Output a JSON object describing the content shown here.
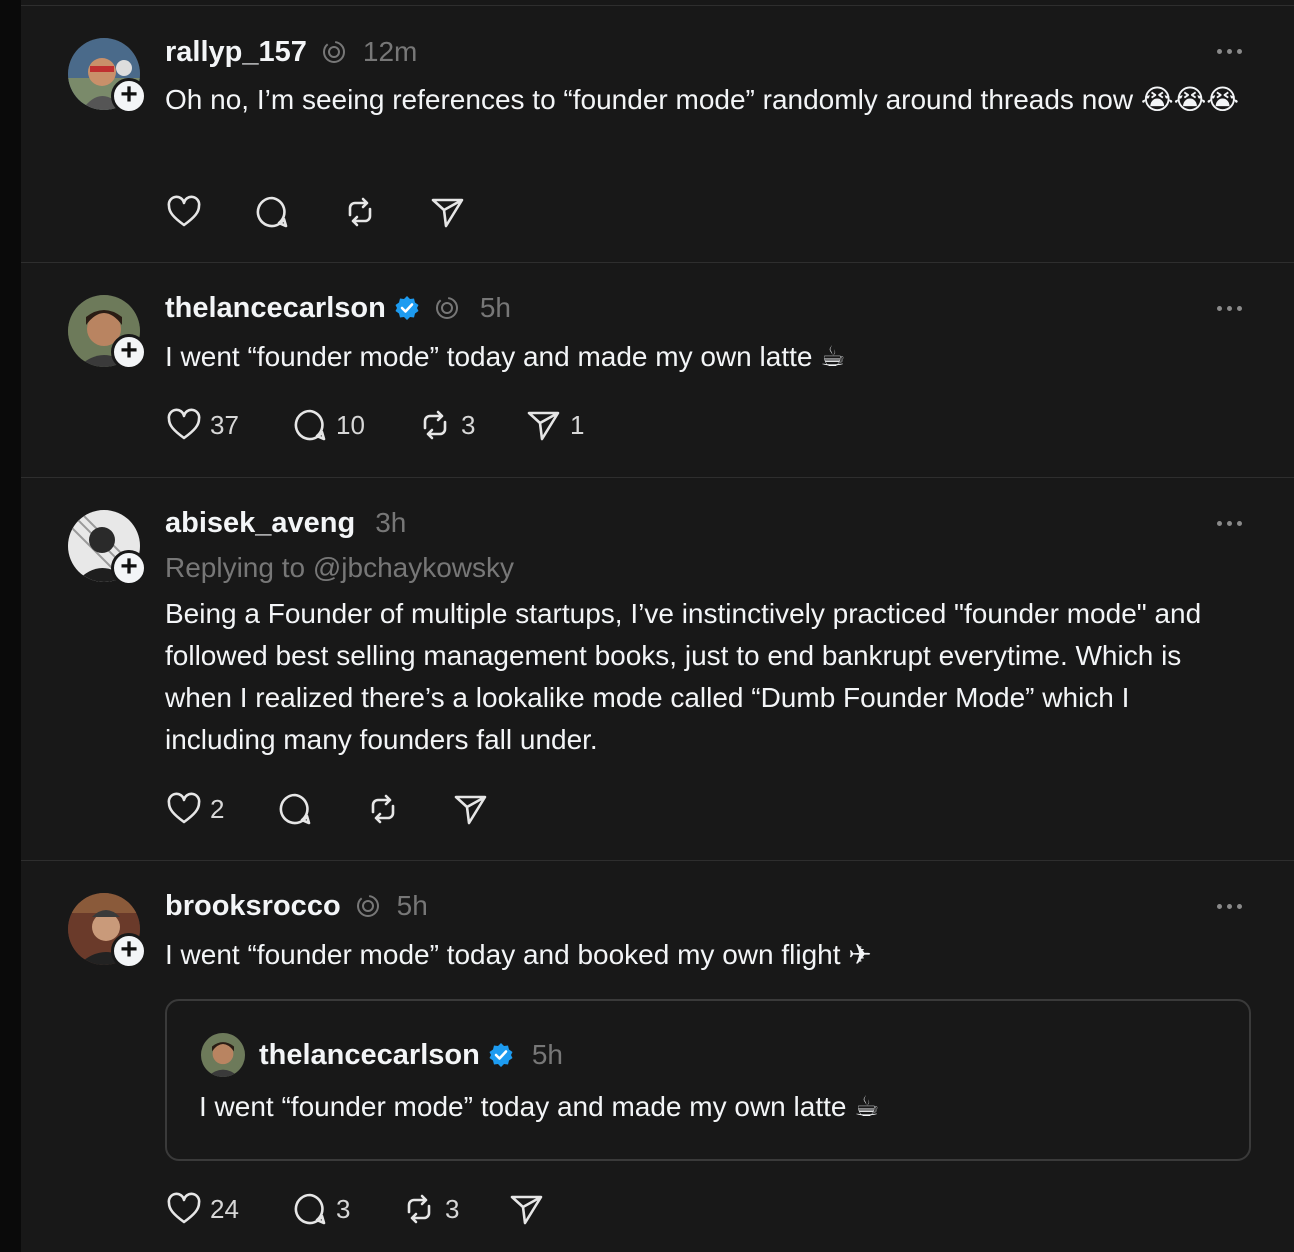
{
  "posts": [
    {
      "username": "rallyp_157",
      "time": "12m",
      "text": "Oh no, I’m seeing references to “founder mode” randomly around threads now 😭😭😭",
      "likes": "",
      "replies": "",
      "reposts": "",
      "shares": ""
    },
    {
      "username": "thelancecarlson",
      "time": "5h",
      "text": "I went “founder mode” today and made my own latte ☕",
      "likes": "37",
      "replies": "10",
      "reposts": "3",
      "shares": "1"
    },
    {
      "username": "abisek_aveng",
      "time": "3h",
      "replying_to": "Replying to @jbchaykowsky",
      "text": "Being a Founder of multiple startups, I’ve instinctively practiced \"founder mode\" and followed best selling management books, just to end bankrupt everytime. Which is when I realized there’s a lookalike mode called “Dumb Founder Mode” which I including many founders fall under.",
      "likes": "2",
      "replies": "",
      "reposts": "",
      "shares": ""
    },
    {
      "username": "brooksrocco",
      "time": "5h",
      "text": "I went “founder mode” today and booked my own flight ✈",
      "quote": {
        "username": "thelancecarlson",
        "time": "5h",
        "text": "I went “founder mode” today and made my own latte ☕"
      },
      "likes": "24",
      "replies": "3",
      "reposts": "3",
      "shares": ""
    }
  ],
  "colors": {
    "background": "#181818",
    "text": "#f3f5f7",
    "muted": "#777777",
    "verified": "#1d9bf0",
    "divider": "#2e2e2e"
  },
  "icons": [
    "heart-icon",
    "comment-icon",
    "repost-icon",
    "share-icon",
    "more-icon",
    "verified-icon",
    "threads-ring-icon",
    "plus-icon"
  ]
}
